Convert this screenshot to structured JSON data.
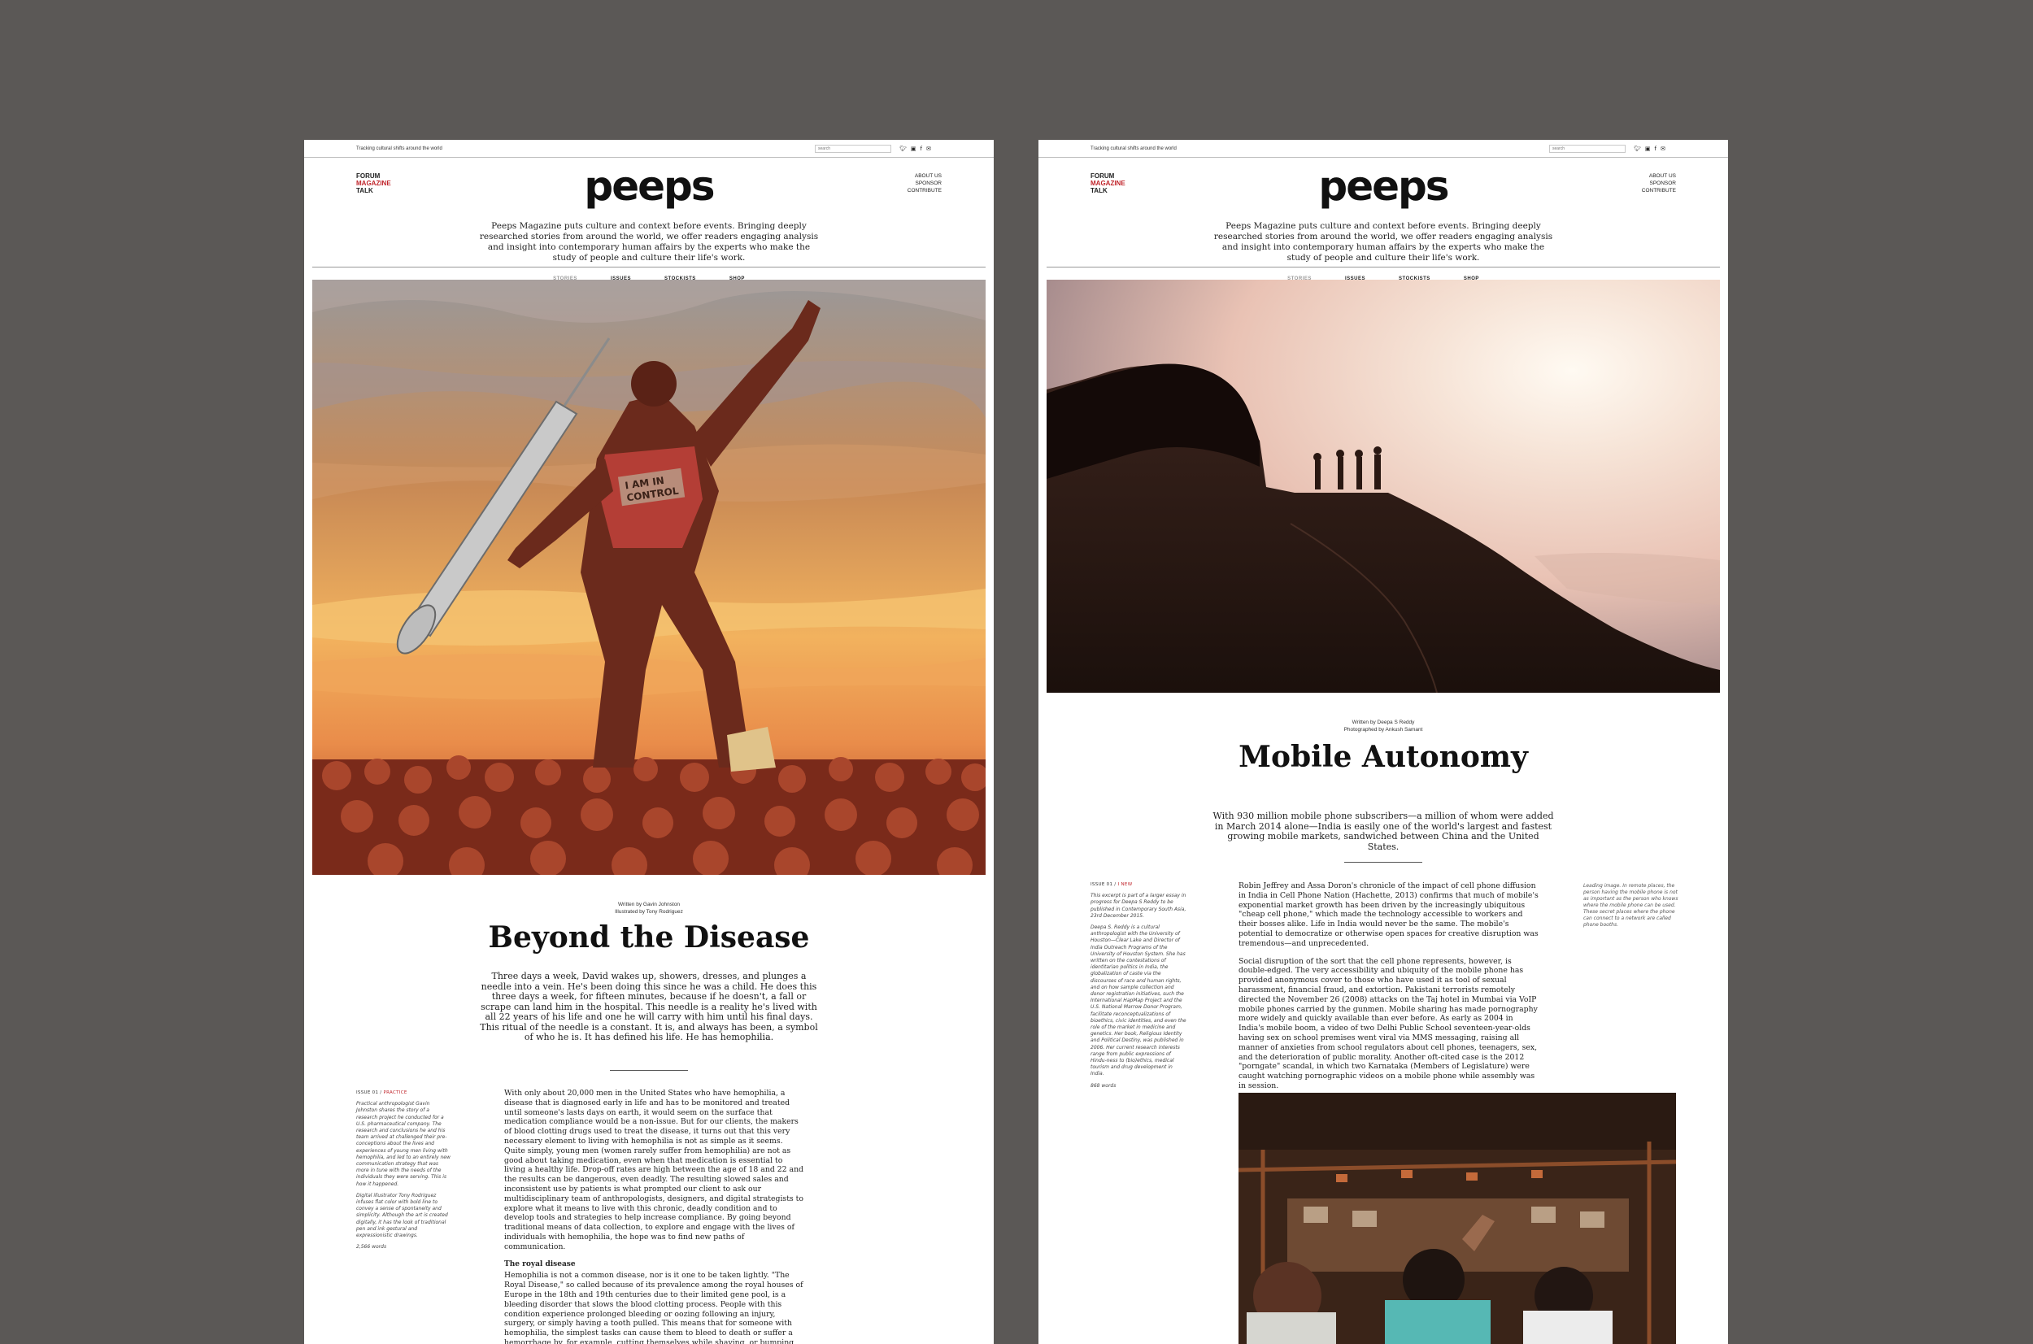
{
  "colors": {
    "background": "#5b5856",
    "accent": "#c0242a",
    "page": "#ffffff"
  },
  "pages": [
    {
      "tagline": "Tracking cultural shifts around the world",
      "search_placeholder": "search",
      "social_icons": [
        "twitter-icon",
        "instagram-icon",
        "facebook-icon",
        "email-icon"
      ],
      "nav_left": [
        "FORUM",
        "MAGAZINE",
        "TALK"
      ],
      "nav_left_active": "MAGAZINE",
      "logo": "peeps",
      "nav_right": [
        "ABOUT US",
        "SPONSOR",
        "CONTRIBUTE"
      ],
      "intro": "Peeps Magazine puts culture and context before events. Bringing deeply researched stories from around the world, we offer readers engaging analysis and insight into contemporary human affairs by the experts who make the study of people and culture their life's work.",
      "section_nav": [
        "STORIES",
        "ISSUES",
        "STOCKISTS",
        "SHOP"
      ],
      "hero_text": "I AM IN CONTROL",
      "credit_1": "Written by Gavin Johnston",
      "credit_2": "Illustrated by Tony Rodriguez",
      "title": "Beyond the Disease",
      "standfirst": "Three days a week, David wakes up, showers, dresses, and plunges a needle into a vein. He's been doing this since he was a child. He does this three days a week, for fifteen minutes, because if he doesn't, a fall or scrape can land him in the hospital. This needle is a reality he's lived with all 22 years of his life and one he will carry with him until his final days. This ritual of the needle is a constant. It is, and always has been, a symbol of who he is. It has defined his life. He has hemophilia.",
      "issue_label": "ISSUE 01 /",
      "issue_section": "PRACTICE",
      "sidebar_p1": "Practical anthropologist Gavin Johnston shares the story of a research project he conducted for a U.S. pharmaceutical company. The research and conclusions he and his team arrived at challenged their pre-conceptions about the lives and experiences of young men living with hemophilia, and led to an entirely new communication strategy that was more in tune with the needs of the individuals they were serving. This is how it happened.",
      "sidebar_p2": "Digital illustrator Tony Rodriguez infuses flat color with bold line to convey a sense of spontaneity and simplicity. Although the art is created digitally, it has the look of traditional pen and ink gestural and expressionistic drawings.",
      "word_count": "2,566 words",
      "body_p1": "With only about 20,000 men in the United States who have hemophilia, a disease that is diagnosed early in life and has to be monitored and treated until someone's lasts days on earth, it would seem on the surface that medication compliance would be a non-issue. But for our clients, the makers of blood clotting drugs used to treat the disease, it turns out that this very necessary element to living with hemophilia is not as simple as it seems. Quite simply, young men (women rarely suffer from hemophilia) are not as good about taking medication, even when that medication is essential to living a healthy life. Drop-off rates are high between the age of 18 and 22 and the results can be dangerous, even deadly. The resulting slowed sales and inconsistent use by patients is what prompted our client to ask our multidisciplinary team of anthropologists, designers, and digital strategists to explore what it means to live with this chronic, deadly condition and to develop tools and strategies to help increase compliance. By going beyond traditional means of data collection, to explore and engage with the lives of individuals with hemophilia, the hope was to find new paths of communication.",
      "body_heading": "The royal disease",
      "body_p2": "Hemophilia is not a common disease, nor is it one to be taken lightly. \"The Royal Disease,\" so called because of its prevalence among the royal houses of Europe in the 18th and 19th centuries due to their limited gene pool, is a bleeding disorder that slows the blood clotting process. People with this condition experience prolonged bleeding or oozing following an injury, surgery, or simply having a tooth pulled. This means that for someone with hemophilia, the simplest tasks can cause them to bleed to death or suffer a hemorrhage by, for example, cutting themselves while shaving, or bumping their knee, or, if the condition is severe enough, simply sitting down."
    },
    {
      "tagline": "Tracking cultural shifts around the world",
      "search_placeholder": "search",
      "social_icons": [
        "twitter-icon",
        "instagram-icon",
        "facebook-icon",
        "email-icon"
      ],
      "nav_left": [
        "FORUM",
        "MAGAZINE",
        "TALK"
      ],
      "nav_left_active": "MAGAZINE",
      "logo": "peeps",
      "nav_right": [
        "ABOUT US",
        "SPONSOR",
        "CONTRIBUTE"
      ],
      "intro": "Peeps Magazine puts culture and context before events. Bringing deeply researched stories from around the world, we offer readers engaging analysis and insight into contemporary human affairs by the experts who make the study of people and culture their life's work.",
      "section_nav": [
        "STORIES",
        "ISSUES",
        "STOCKISTS",
        "SHOP"
      ],
      "credit_1": "Written by Deepa S Reddy",
      "credit_2": "Photographed by Ankush Samant",
      "title": "Mobile Autonomy",
      "standfirst": "With 930 million mobile phone subscribers—a million of whom were added in March 2014 alone—India is easily one of the world's largest and fastest growing mobile markets, sandwiched between China and the United States.",
      "issue_label": "ISSUE 01 /",
      "issue_section": "I NEW",
      "sidebar_p1": "This excerpt is part of a larger essay in progress for Deepa S Reddy to be published in Contemporary South Asia, 23rd December 2015.",
      "sidebar_p2": "Deepa S. Reddy is a cultural anthropologist with the University of Houston—Clear Lake and Director of India Outreach Programs of the University of Houston System. She has written on the contestations of identitarian politics in India, the globalization of caste via the discourses of race and human rights, and on how sample collection and donor registration initiatives, such the International HapMap Project and the U.S. National Marrow Donor Program, facilitate reconceptualizations of bioethics, civic identities, and even the role of the market in medicine and genetics. Her book, Religious Identity and Political Destiny, was published in 2006. Her current research interests range from public expressions of Hindu-ness to (bio)ethics, medical tourism and drug development in India.",
      "word_count": "868 words",
      "body_p1": "Robin Jeffrey and Assa Doron's chronicle of the impact of cell phone diffusion in India in Cell Phone Nation (Hachette, 2013) confirms that much of mobile's exponential market growth has been driven by the increasingly ubiquitous \"cheap cell phone,\" which made the technology accessible to workers and their bosses alike. Life in India would never be the same. The mobile's potential to democratize or otherwise open spaces for creative disruption was tremendous—and unprecedented.",
      "body_p2": "Social disruption of the sort that the cell phone represents, however, is double-edged. The very accessibility and ubiquity of the mobile phone has provided anonymous cover to those who have used it as tool of sexual harassment, financial fraud, and extortion. Pakistani terrorists remotely directed the November 26 (2008) attacks on the Taj hotel in Mumbai via VoIP mobile phones carried by the gunmen. Mobile sharing has made pornography more widely and quickly available than ever before. As early as 2004 in India's mobile boom, a video of two Delhi Public School seventeen-year-olds having sex on school premises went viral via MMS messaging, raising all manner of anxieties from school regulators about cell phones, teenagers, sex, and the deterioration of public morality. Another oft-cited case is the 2012 \"porngate\" scandal, in which two Karnataka (Members of Legislature) were caught watching pornographic videos on a mobile phone while assembly was in session.",
      "caption": "Leading image. In remote places, the person having the mobile phone is not as important as the person who knows where the mobile phone can be used. These secret places where the phone can connect to a network are called phone booths."
    }
  ]
}
